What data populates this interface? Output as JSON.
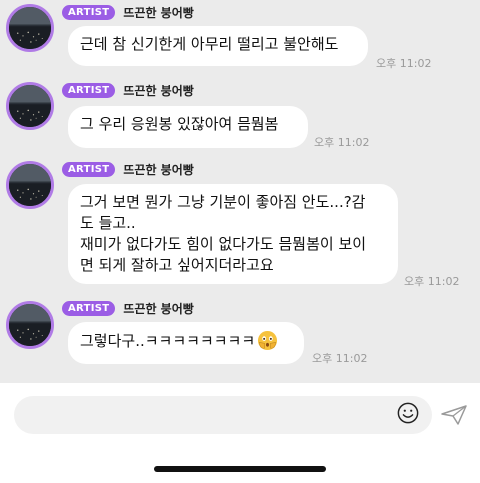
{
  "app": "KakaoTalk chat",
  "colors": {
    "badge": "#9b5de5",
    "avatar_border": "#b07be6",
    "background": "#ebebeb",
    "bubble": "#ffffff"
  },
  "messages": [
    {
      "badge": "ARTIST",
      "sender": "뜨끈한 붕어빵",
      "lines": [
        "근데 참 신기한게 아무리 떨리고 불안해도"
      ],
      "time": "오후 11:02",
      "show_header": true
    },
    {
      "badge": "ARTIST",
      "sender": "뜨끈한 붕어빵",
      "lines": [
        "그 우리 응원봉 있잖아여 믐뭠봄"
      ],
      "time": "오후 11:02",
      "show_header": true
    },
    {
      "badge": "ARTIST",
      "sender": "뜨끈한 붕어빵",
      "lines": [
        "그거 보면 뭔가 그냥 기분이 좋아짐 안도...?감",
        "도 들고..",
        "재미가 없다가도 힘이 없다가도 믐뭠봄이 보이",
        "면 되게 잘하고 싶어지더라고요"
      ],
      "time": "오후 11:02",
      "show_header": true
    },
    {
      "badge": "ARTIST",
      "sender": "뜨끈한 붕어빵",
      "lines": [
        "그렇다구..ㅋㅋㅋㅋㅋㅋㅋㅋ"
      ],
      "emoji": "flushed-face-hands-icon",
      "time": "오후 11:02",
      "show_header": true
    }
  ],
  "input": {
    "placeholder": "",
    "emoji_icon": "smiley-icon",
    "send_icon": "send-plane-icon"
  }
}
